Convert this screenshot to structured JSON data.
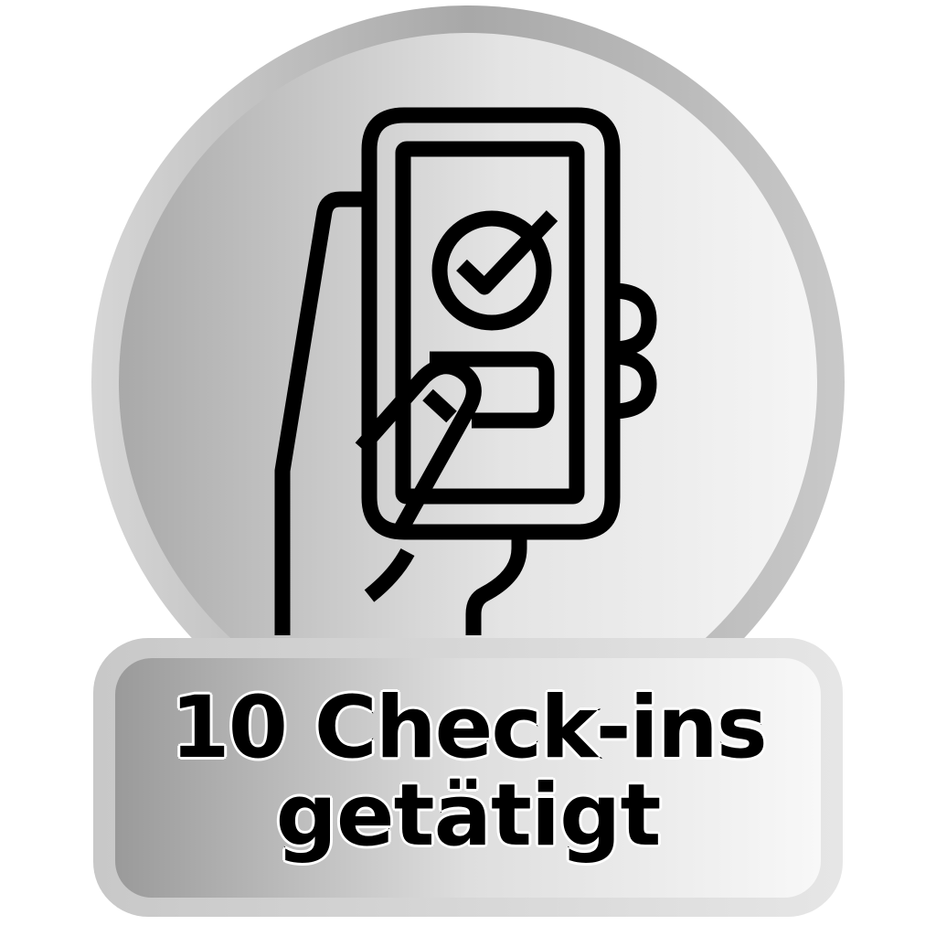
{
  "badge": {
    "label_line_1": "10 Check-ins",
    "label_line_2": "getätigt",
    "icon": "hand-holding-phone-check-icon"
  },
  "colors": {
    "circle_light": "#f4f4f4",
    "circle_dark": "#a9a9a9",
    "ring": "#9e9e9e",
    "plate_light": "#f7f7f7",
    "plate_dark": "#999999",
    "stroke": "#000000"
  }
}
